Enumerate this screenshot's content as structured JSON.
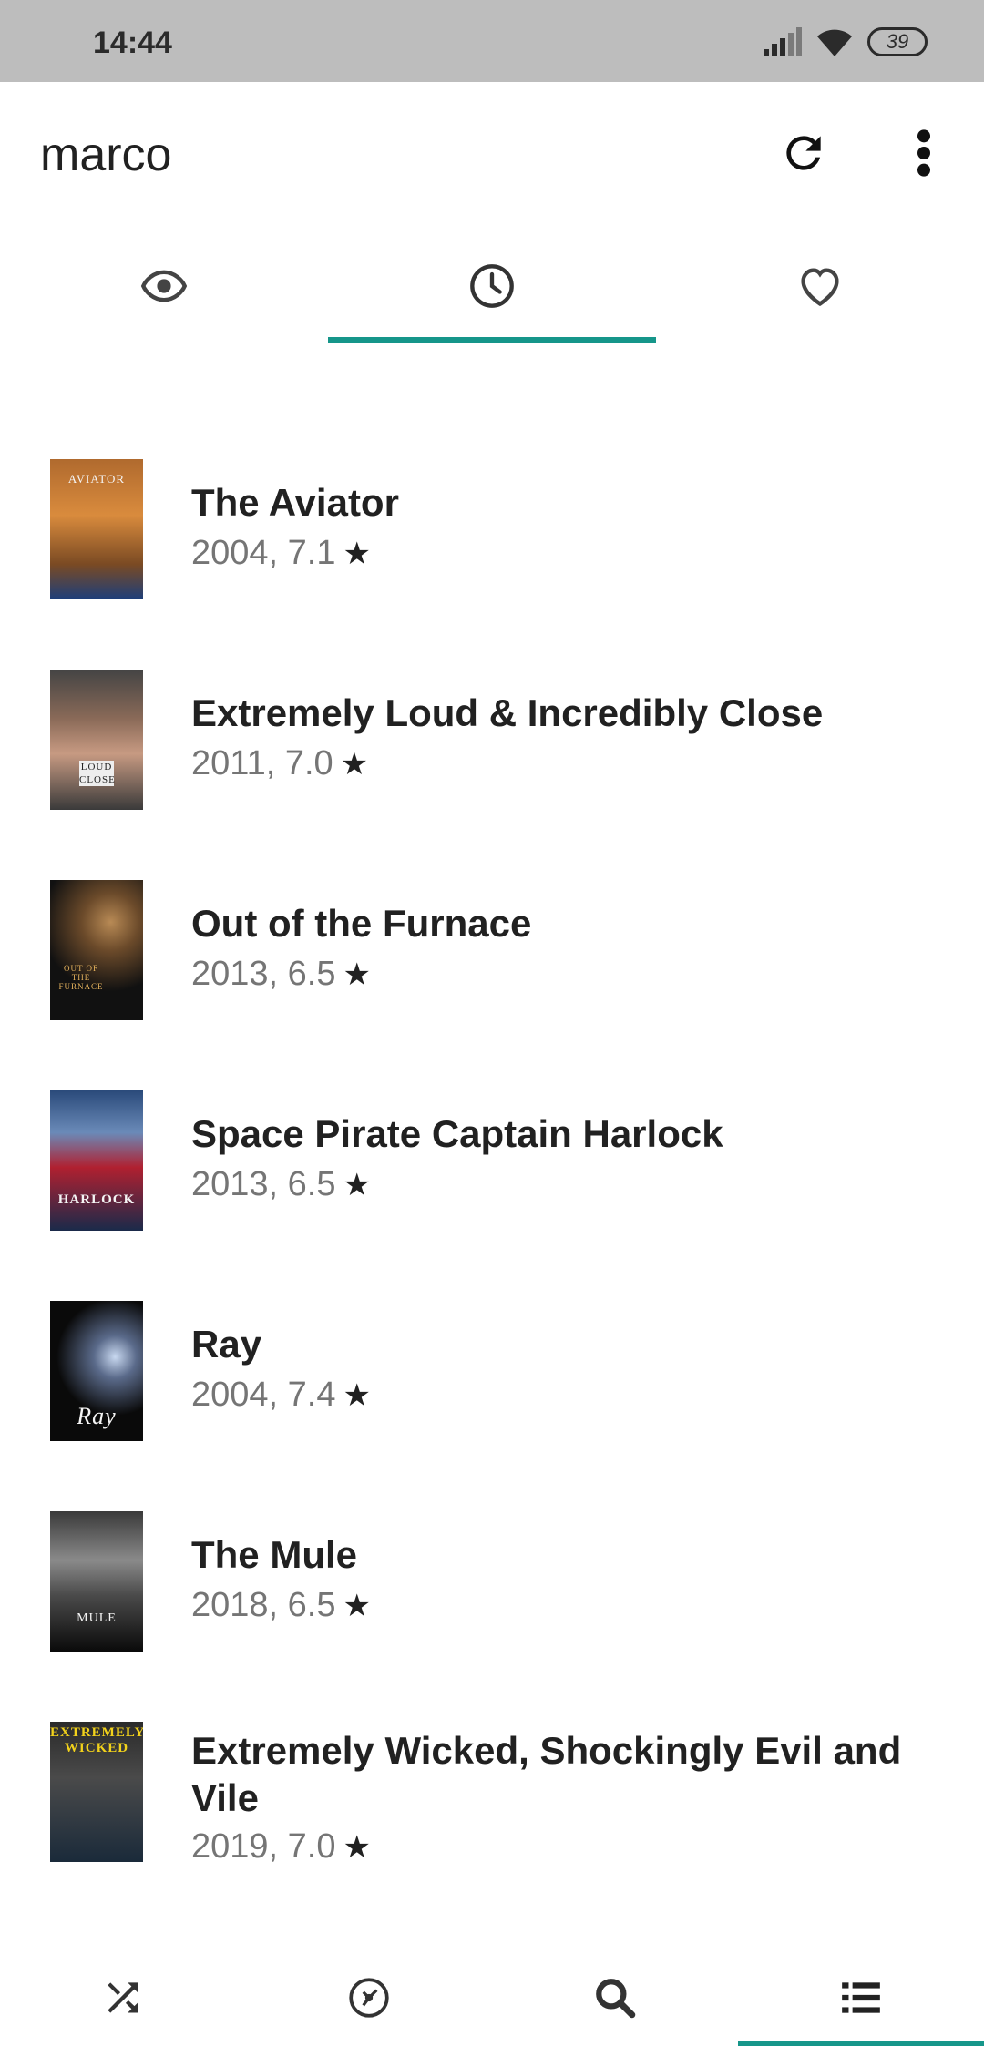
{
  "status": {
    "time": "14:44",
    "battery": "39"
  },
  "appbar": {
    "title": "marco",
    "refresh_icon": "refresh-icon",
    "more_icon": "more-vert-icon"
  },
  "tabs": [
    {
      "name": "watched",
      "icon": "eye-icon",
      "selected": false
    },
    {
      "name": "watchlist",
      "icon": "clock-icon",
      "selected": true
    },
    {
      "name": "favorites",
      "icon": "heart-icon",
      "selected": false
    }
  ],
  "accent": "#16968a",
  "movies": [
    {
      "title": "The Aviator",
      "meta": "2004, 7.1",
      "poster_text": "AVIATOR"
    },
    {
      "title": "Extremely Loud & Incredibly Close",
      "meta": "2011, 7.0",
      "poster_text": "LOUD CLOSE"
    },
    {
      "title": "Out of the Furnace",
      "meta": "2013, 6.5",
      "poster_text": "OUT OF THE FURNACE"
    },
    {
      "title": "Space Pirate Captain Harlock",
      "meta": "2013, 6.5",
      "poster_text": "HARLOCK"
    },
    {
      "title": "Ray",
      "meta": "2004, 7.4",
      "poster_text": "Ray"
    },
    {
      "title": "The Mule",
      "meta": "2018, 6.5",
      "poster_text": "MULE"
    },
    {
      "title": "Extremely Wicked, Shockingly Evil and Vile",
      "meta": "2019, 7.0",
      "poster_text": "EXTREMELY WICKED"
    }
  ],
  "star_glyph": "★",
  "bottom_nav": [
    {
      "name": "random",
      "icon": "shuffle-icon"
    },
    {
      "name": "discover",
      "icon": "film-reel-icon"
    },
    {
      "name": "search",
      "icon": "search-icon"
    },
    {
      "name": "lists",
      "icon": "list-icon",
      "selected": true
    }
  ]
}
